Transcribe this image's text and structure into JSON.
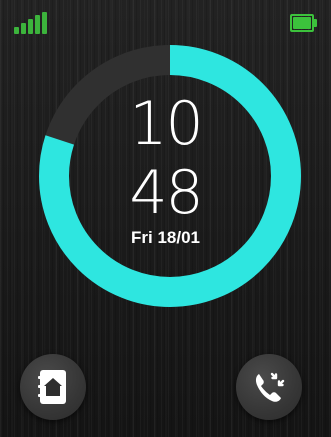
{
  "status_bar": {
    "signal_bars": 5,
    "signal_icon": "signal-strength-icon",
    "battery_icon": "battery-icon",
    "battery_level_percent": 100,
    "signal_color": "#3cb43c",
    "battery_color": "#3cc23c"
  },
  "clock": {
    "hours": "10",
    "minutes": "48",
    "date": "Fri 18/01",
    "progress_fraction": 0.8,
    "ring_color": "#2ee6e0",
    "ring_track_color": "#303030"
  },
  "bottom_bar": {
    "left_button_icon": "contacts-book-icon",
    "right_button_icon": "call-log-icon"
  }
}
